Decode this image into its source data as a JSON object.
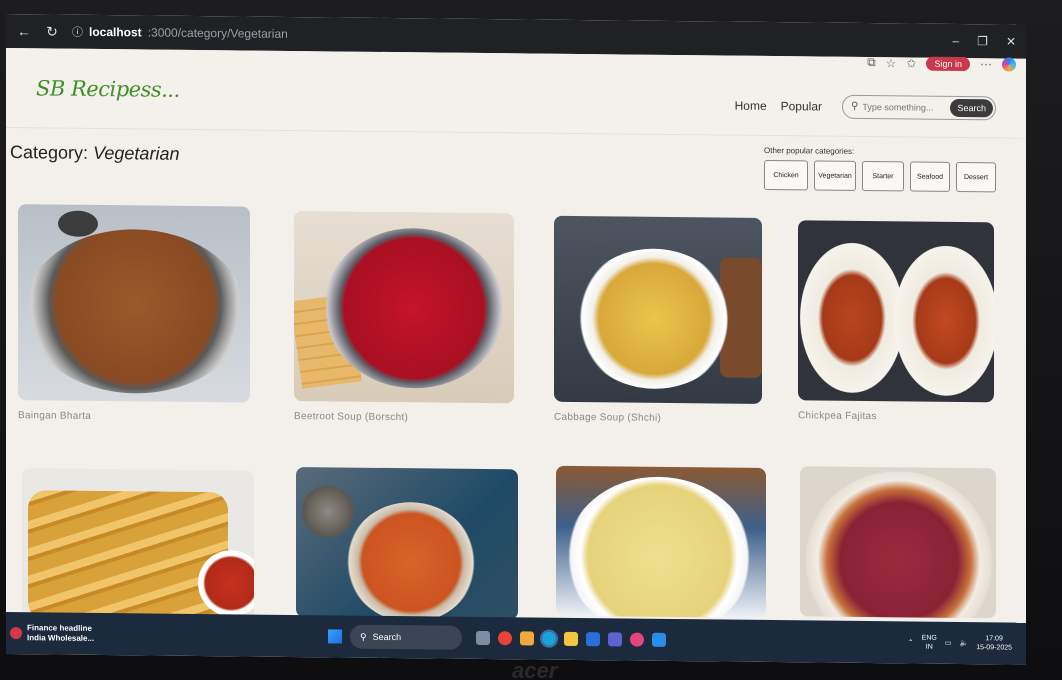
{
  "browser": {
    "url_host": "localhost",
    "url_path": ":3000/category/Vegetarian",
    "signin_label": "Sign in"
  },
  "site": {
    "logo": "SB Recipess...",
    "nav": {
      "home": "Home",
      "popular": "Popular"
    },
    "search": {
      "placeholder": "Type something...",
      "button": "Search"
    }
  },
  "category": {
    "label": "Category:",
    "name": "Vegetarian",
    "other_label": "Other popular categories:",
    "buttons": [
      "Chicken",
      "Vegetarian",
      "Starter",
      "Seafood",
      "Dessert"
    ]
  },
  "recipes": [
    {
      "name": "Baingan Bharta"
    },
    {
      "name": "Beetroot Soup (Borscht)"
    },
    {
      "name": "Cabbage Soup (Shchi)"
    },
    {
      "name": "Chickpea Fajitas"
    },
    {
      "name": ""
    },
    {
      "name": ""
    },
    {
      "name": ""
    },
    {
      "name": ""
    }
  ],
  "taskbar": {
    "news_line1": "Finance headline",
    "news_line2": "India Wholesale...",
    "search": "Search",
    "lang_line1": "ENG",
    "lang_line2": "IN",
    "time": "17:09",
    "date": "15-09-2025"
  },
  "brand": "acer"
}
